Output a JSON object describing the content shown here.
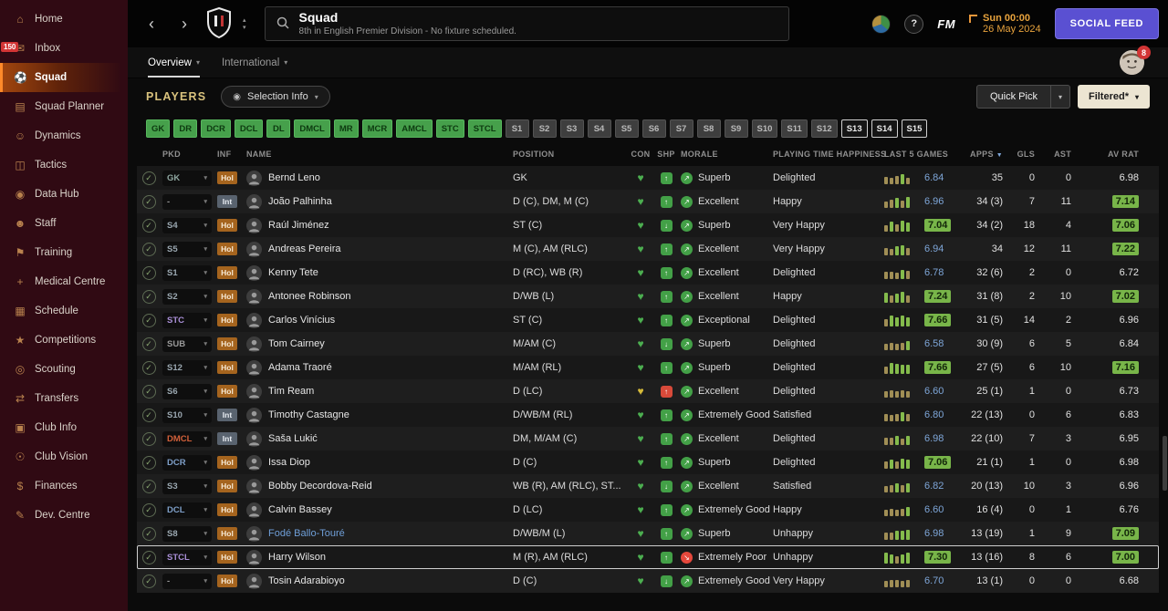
{
  "sidebar": {
    "items": [
      {
        "label": "Home",
        "icon": "⌂"
      },
      {
        "label": "Inbox",
        "icon": "✉",
        "badge": "150"
      },
      {
        "label": "Squad",
        "icon": "⚽",
        "active": true
      },
      {
        "label": "Squad Planner",
        "icon": "▤"
      },
      {
        "label": "Dynamics",
        "icon": "☺"
      },
      {
        "label": "Tactics",
        "icon": "◫"
      },
      {
        "label": "Data Hub",
        "icon": "◉"
      },
      {
        "label": "Staff",
        "icon": "☻"
      },
      {
        "label": "Training",
        "icon": "⚑"
      },
      {
        "label": "Medical Centre",
        "icon": "+"
      },
      {
        "label": "Schedule",
        "icon": "▦"
      },
      {
        "label": "Competitions",
        "icon": "★"
      },
      {
        "label": "Scouting",
        "icon": "◎"
      },
      {
        "label": "Transfers",
        "icon": "⇄"
      },
      {
        "label": "Club Info",
        "icon": "▣"
      },
      {
        "label": "Club Vision",
        "icon": "☉"
      },
      {
        "label": "Finances",
        "icon": "$"
      },
      {
        "label": "Dev. Centre",
        "icon": "✎"
      }
    ]
  },
  "header": {
    "title": "Squad",
    "subtitle": "8th in English Premier Division - No fixture scheduled.",
    "help_label": "?",
    "fm_logo": "FM",
    "datetime_line1": "Sun 00:00",
    "datetime_line2": "26 May 2024",
    "social_feed_label": "SOCIAL FEED"
  },
  "tabs": {
    "overview": "Overview",
    "international": "International",
    "notification_count": "8"
  },
  "toolbar": {
    "section_title": "PLAYERS",
    "selection_info_label": "Selection Info",
    "quick_pick_label": "Quick Pick",
    "filtered_label": "Filtered*"
  },
  "filters": {
    "positions": [
      "GK",
      "DR",
      "DCR",
      "DCL",
      "DL",
      "DMCL",
      "MR",
      "MCR",
      "AMCL",
      "STC",
      "STCL"
    ],
    "slots": [
      "S1",
      "S2",
      "S3",
      "S4",
      "S5",
      "S6",
      "S7",
      "S8",
      "S9",
      "S10",
      "S11",
      "S12"
    ],
    "slots_alt": [
      "S13",
      "S14",
      "S15"
    ]
  },
  "colors": {
    "accent_orange": "#ff8a2a",
    "rating_good_bg": "#78b549",
    "social_feed_purple": "#5a50d2",
    "morale_good": "#43a047",
    "morale_bad": "#e5483c",
    "heart_green": "#4caf50",
    "heart_yellow": "#d6bb3a"
  },
  "table": {
    "columns": [
      {
        "label": "PKD"
      },
      {
        "label": "INF"
      },
      {
        "label": "NAME"
      },
      {
        "label": "POSITION"
      },
      {
        "label": "CON"
      },
      {
        "label": "SHP"
      },
      {
        "label": "MORALE"
      },
      {
        "label": "PLAYING TIME HAPPINESS"
      },
      {
        "label": "LAST 5 GAMES"
      },
      {
        "label": "APPS",
        "sorted": "desc"
      },
      {
        "label": "GLS"
      },
      {
        "label": "AST"
      },
      {
        "label": "AV RAT"
      }
    ],
    "rows": [
      {
        "pkd": "GK",
        "pkd_color": "#8fa7a0",
        "inf": "Hol",
        "name": "Bernd Leno",
        "position": "GK",
        "con": "#4caf50",
        "shp_color": "#43a047",
        "shp_dir": "up",
        "morale": "Superb",
        "morale_color": "#43a047",
        "happiness": "Delighted",
        "last5_bars": [
          [
            "t",
            60
          ],
          [
            "t",
            50
          ],
          [
            "t",
            70
          ],
          [
            "g",
            85
          ],
          [
            "t",
            55
          ]
        ],
        "last5_rating": "6.84",
        "last5_good": false,
        "apps": "35",
        "gls": "0",
        "ast": "0",
        "avrat": "6.98",
        "avrat_good": false
      },
      {
        "pkd": "-",
        "pkd_color": "#9a9a9a",
        "inf": "Int",
        "name": "João Palhinha",
        "position": "D (C), DM, M (C)",
        "con": "#4caf50",
        "shp_color": "#43a047",
        "shp_dir": "up",
        "morale": "Excellent",
        "morale_color": "#43a047",
        "happiness": "Happy",
        "last5_bars": [
          [
            "t",
            55
          ],
          [
            "t",
            70
          ],
          [
            "g",
            85
          ],
          [
            "t",
            60
          ],
          [
            "g",
            90
          ]
        ],
        "last5_rating": "6.96",
        "last5_good": false,
        "apps": "34 (3)",
        "gls": "7",
        "ast": "11",
        "avrat": "7.14",
        "avrat_good": true
      },
      {
        "pkd": "S4",
        "pkd_color": "#9aa7b0",
        "inf": "Hol",
        "name": "Raúl Jiménez",
        "position": "ST (C)",
        "con": "#4caf50",
        "shp_color": "#43a047",
        "shp_dir": "down",
        "morale": "Superb",
        "morale_color": "#43a047",
        "happiness": "Very Happy",
        "last5_bars": [
          [
            "t",
            55
          ],
          [
            "g",
            85
          ],
          [
            "t",
            65
          ],
          [
            "g",
            90
          ],
          [
            "g",
            75
          ]
        ],
        "last5_rating": "7.04",
        "last5_good": true,
        "apps": "34 (2)",
        "gls": "18",
        "ast": "4",
        "avrat": "7.06",
        "avrat_good": true
      },
      {
        "pkd": "S5",
        "pkd_color": "#9aa7b0",
        "inf": "Hol",
        "name": "Andreas Pereira",
        "position": "M (C), AM (RLC)",
        "con": "#4caf50",
        "shp_color": "#43a047",
        "shp_dir": "up",
        "morale": "Excellent",
        "morale_color": "#43a047",
        "happiness": "Very Happy",
        "last5_bars": [
          [
            "t",
            65
          ],
          [
            "t",
            55
          ],
          [
            "g",
            80
          ],
          [
            "g",
            85
          ],
          [
            "t",
            60
          ]
        ],
        "last5_rating": "6.94",
        "last5_good": false,
        "apps": "34",
        "gls": "12",
        "ast": "11",
        "avrat": "7.22",
        "avrat_good": true
      },
      {
        "pkd": "S1",
        "pkd_color": "#9aa7b0",
        "inf": "Hol",
        "name": "Kenny Tete",
        "position": "D (RC), WB (R)",
        "con": "#4caf50",
        "shp_color": "#43a047",
        "shp_dir": "up",
        "morale": "Excellent",
        "morale_color": "#43a047",
        "happiness": "Delighted",
        "last5_bars": [
          [
            "t",
            60
          ],
          [
            "t",
            65
          ],
          [
            "t",
            55
          ],
          [
            "g",
            80
          ],
          [
            "t",
            70
          ]
        ],
        "last5_rating": "6.78",
        "last5_good": false,
        "apps": "32 (6)",
        "gls": "2",
        "ast": "0",
        "avrat": "6.72",
        "avrat_good": false
      },
      {
        "pkd": "S2",
        "pkd_color": "#9aa7b0",
        "inf": "Hol",
        "name": "Antonee Robinson",
        "position": "D/WB (L)",
        "con": "#4caf50",
        "shp_color": "#43a047",
        "shp_dir": "up",
        "morale": "Excellent",
        "morale_color": "#43a047",
        "happiness": "Happy",
        "last5_bars": [
          [
            "g",
            85
          ],
          [
            "t",
            60
          ],
          [
            "g",
            75
          ],
          [
            "g",
            90
          ],
          [
            "t",
            65
          ]
        ],
        "last5_rating": "7.24",
        "last5_good": true,
        "apps": "31 (8)",
        "gls": "2",
        "ast": "10",
        "avrat": "7.02",
        "avrat_good": true
      },
      {
        "pkd": "STC",
        "pkd_color": "#a98fd6",
        "inf": "Hol",
        "name": "Carlos Vinícius",
        "position": "ST (C)",
        "con": "#4caf50",
        "shp_color": "#43a047",
        "shp_dir": "up",
        "morale": "Exceptional",
        "morale_color": "#43a047",
        "happiness": "Delighted",
        "last5_bars": [
          [
            "t",
            60
          ],
          [
            "g",
            90
          ],
          [
            "g",
            80
          ],
          [
            "g",
            95
          ],
          [
            "g",
            75
          ]
        ],
        "last5_rating": "7.66",
        "last5_good": true,
        "apps": "31 (5)",
        "gls": "14",
        "ast": "2",
        "avrat": "6.96",
        "avrat_good": false
      },
      {
        "pkd": "SUB",
        "pkd_color": "#9a9a9a",
        "inf": "Hol",
        "name": "Tom Cairney",
        "position": "M/AM (C)",
        "con": "#4caf50",
        "shp_color": "#43a047",
        "shp_dir": "down",
        "morale": "Superb",
        "morale_color": "#43a047",
        "happiness": "Delighted",
        "last5_bars": [
          [
            "t",
            55
          ],
          [
            "t",
            65
          ],
          [
            "t",
            50
          ],
          [
            "t",
            60
          ],
          [
            "g",
            75
          ]
        ],
        "last5_rating": "6.58",
        "last5_good": false,
        "apps": "30 (9)",
        "gls": "6",
        "ast": "5",
        "avrat": "6.84",
        "avrat_good": false
      },
      {
        "pkd": "S12",
        "pkd_color": "#9aa7b0",
        "inf": "Hol",
        "name": "Adama Traoré",
        "position": "M/AM (RL)",
        "con": "#4caf50",
        "shp_color": "#43a047",
        "shp_dir": "up",
        "morale": "Superb",
        "morale_color": "#43a047",
        "happiness": "Delighted",
        "last5_bars": [
          [
            "t",
            60
          ],
          [
            "g",
            95
          ],
          [
            "g",
            85
          ],
          [
            "g",
            80
          ],
          [
            "g",
            75
          ]
        ],
        "last5_rating": "7.66",
        "last5_good": true,
        "apps": "27 (5)",
        "gls": "6",
        "ast": "10",
        "avrat": "7.16",
        "avrat_good": true
      },
      {
        "pkd": "S6",
        "pkd_color": "#9aa7b0",
        "inf": "Hol",
        "name": "Tim Ream",
        "position": "D (LC)",
        "con": "#d6bb3a",
        "shp_color": "#d84a3a",
        "shp_dir": "up",
        "morale": "Excellent",
        "morale_color": "#43a047",
        "happiness": "Delighted",
        "last5_bars": [
          [
            "t",
            55
          ],
          [
            "t",
            60
          ],
          [
            "t",
            50
          ],
          [
            "t",
            65
          ],
          [
            "t",
            55
          ]
        ],
        "last5_rating": "6.60",
        "last5_good": false,
        "apps": "25 (1)",
        "gls": "1",
        "ast": "0",
        "avrat": "6.73",
        "avrat_good": false
      },
      {
        "pkd": "S10",
        "pkd_color": "#9aa7b0",
        "inf": "Int",
        "name": "Timothy Castagne",
        "position": "D/WB/M (RL)",
        "con": "#4caf50",
        "shp_color": "#43a047",
        "shp_dir": "up",
        "morale": "Extremely Good",
        "morale_color": "#43a047",
        "happiness": "Satisfied",
        "last5_bars": [
          [
            "t",
            60
          ],
          [
            "t",
            55
          ],
          [
            "t",
            65
          ],
          [
            "g",
            75
          ],
          [
            "t",
            60
          ]
        ],
        "last5_rating": "6.80",
        "last5_good": false,
        "apps": "22 (13)",
        "gls": "0",
        "ast": "6",
        "avrat": "6.83",
        "avrat_good": false
      },
      {
        "pkd": "DMCL",
        "pkd_color": "#d2603a",
        "inf": "Int",
        "name": "Saša Lukić",
        "position": "DM, M/AM (C)",
        "con": "#4caf50",
        "shp_color": "#43a047",
        "shp_dir": "up",
        "morale": "Excellent",
        "morale_color": "#43a047",
        "happiness": "Delighted",
        "last5_bars": [
          [
            "t",
            65
          ],
          [
            "t",
            60
          ],
          [
            "g",
            80
          ],
          [
            "t",
            55
          ],
          [
            "g",
            75
          ]
        ],
        "last5_rating": "6.98",
        "last5_good": false,
        "apps": "22 (10)",
        "gls": "7",
        "ast": "3",
        "avrat": "6.95",
        "avrat_good": false
      },
      {
        "pkd": "DCR",
        "pkd_color": "#7e9fc8",
        "inf": "Hol",
        "name": "Issa Diop",
        "position": "D (C)",
        "con": "#4caf50",
        "shp_color": "#43a047",
        "shp_dir": "up",
        "morale": "Superb",
        "morale_color": "#43a047",
        "happiness": "Delighted",
        "last5_bars": [
          [
            "t",
            60
          ],
          [
            "g",
            80
          ],
          [
            "t",
            65
          ],
          [
            "g",
            85
          ],
          [
            "g",
            75
          ]
        ],
        "last5_rating": "7.06",
        "last5_good": true,
        "apps": "21 (1)",
        "gls": "1",
        "ast": "0",
        "avrat": "6.98",
        "avrat_good": false
      },
      {
        "pkd": "S3",
        "pkd_color": "#9aa7b0",
        "inf": "Hol",
        "name": "Bobby Decordova-Reid",
        "position": "WB (R), AM (RLC), ST...",
        "con": "#4caf50",
        "shp_color": "#43a047",
        "shp_dir": "down",
        "morale": "Excellent",
        "morale_color": "#43a047",
        "happiness": "Satisfied",
        "last5_bars": [
          [
            "t",
            55
          ],
          [
            "t",
            65
          ],
          [
            "g",
            80
          ],
          [
            "t",
            60
          ],
          [
            "g",
            75
          ]
        ],
        "last5_rating": "6.82",
        "last5_good": false,
        "apps": "20 (13)",
        "gls": "10",
        "ast": "3",
        "avrat": "6.96",
        "avrat_good": false
      },
      {
        "pkd": "DCL",
        "pkd_color": "#7e9fc8",
        "inf": "Hol",
        "name": "Calvin Bassey",
        "position": "D (LC)",
        "con": "#4caf50",
        "shp_color": "#43a047",
        "shp_dir": "up",
        "morale": "Extremely Good",
        "morale_color": "#43a047",
        "happiness": "Happy",
        "last5_bars": [
          [
            "t",
            55
          ],
          [
            "t",
            60
          ],
          [
            "t",
            50
          ],
          [
            "t",
            65
          ],
          [
            "g",
            75
          ]
        ],
        "last5_rating": "6.60",
        "last5_good": false,
        "apps": "16 (4)",
        "gls": "0",
        "ast": "1",
        "avrat": "6.76",
        "avrat_good": false
      },
      {
        "pkd": "S8",
        "pkd_color": "#9aa7b0",
        "inf": "Hol",
        "name": "Fodé Ballo-Touré",
        "name_color": "#6f9fd8",
        "position": "D/WB/M (L)",
        "con": "#4caf50",
        "shp_color": "#43a047",
        "shp_dir": "up",
        "morale": "Superb",
        "morale_color": "#43a047",
        "happiness": "Unhappy",
        "last5_bars": [
          [
            "t",
            60
          ],
          [
            "t",
            65
          ],
          [
            "g",
            80
          ],
          [
            "g",
            75
          ],
          [
            "g",
            85
          ]
        ],
        "last5_rating": "6.98",
        "last5_good": false,
        "apps": "13 (19)",
        "gls": "1",
        "ast": "9",
        "avrat": "7.09",
        "avrat_good": true
      },
      {
        "pkd": "STCL",
        "pkd_color": "#a98fd6",
        "inf": "Hol",
        "name": "Harry Wilson",
        "position": "M (R), AM (RLC)",
        "con": "#4caf50",
        "shp_color": "#43a047",
        "shp_dir": "up",
        "morale": "Extremely Poor",
        "morale_color": "#e5483c",
        "happiness": "Unhappy",
        "last5_bars": [
          [
            "g",
            90
          ],
          [
            "g",
            80
          ],
          [
            "t",
            60
          ],
          [
            "g",
            75
          ],
          [
            "g",
            95
          ]
        ],
        "last5_rating": "7.30",
        "last5_good": true,
        "apps": "13 (16)",
        "gls": "8",
        "ast": "6",
        "avrat": "7.00",
        "avrat_good": true,
        "selected": true
      },
      {
        "pkd": "-",
        "pkd_color": "#9a9a9a",
        "inf": "Hol",
        "name": "Tosin Adarabioyo",
        "position": "D (C)",
        "con": "#4caf50",
        "shp_color": "#43a047",
        "shp_dir": "down",
        "morale": "Extremely Good",
        "morale_color": "#43a047",
        "happiness": "Very Happy",
        "last5_bars": [
          [
            "t",
            55
          ],
          [
            "t",
            60
          ],
          [
            "t",
            65
          ],
          [
            "t",
            55
          ],
          [
            "t",
            60
          ]
        ],
        "last5_rating": "6.70",
        "last5_good": false,
        "apps": "13 (1)",
        "gls": "0",
        "ast": "0",
        "avrat": "6.68",
        "avrat_good": false
      }
    ]
  }
}
